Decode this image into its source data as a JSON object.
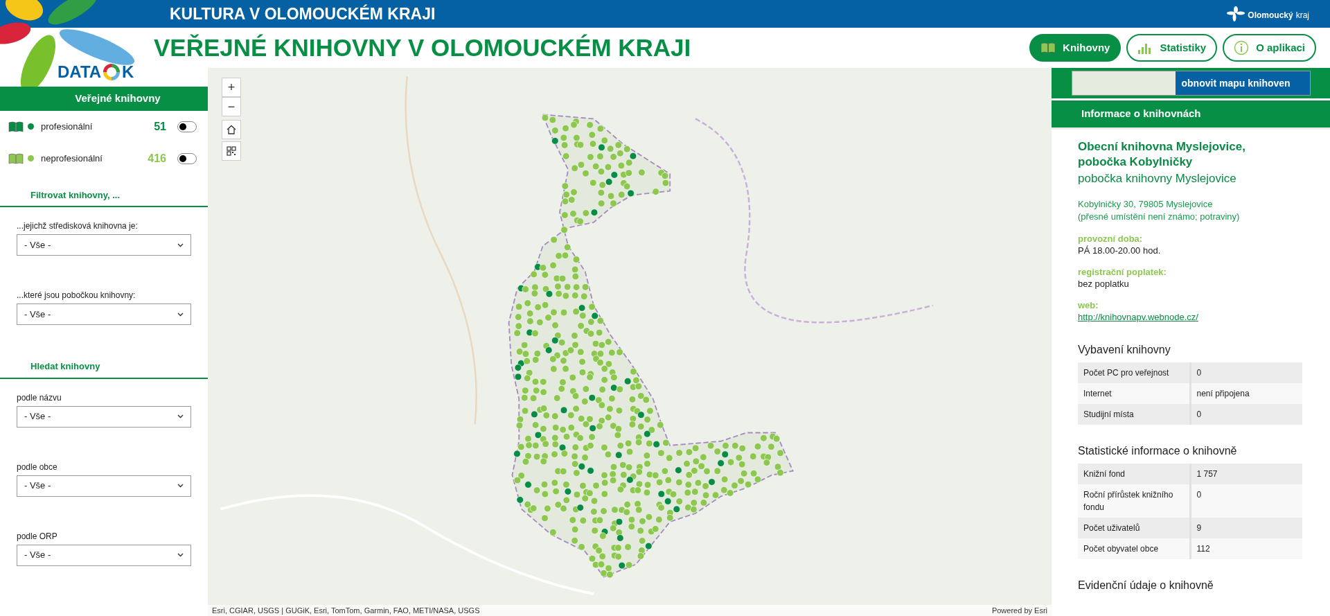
{
  "header": {
    "banner_title": "KULTURA V OLOMOUCKÉM KRAJI",
    "region_logo": {
      "name": "Olomoucký",
      "suffix": "kraj"
    },
    "logo": {
      "text": "DATA",
      "suffix": "K"
    },
    "app_title": "VEŘEJNÉ KNIHOVNY V OLOMOUCKÉM KRAJI",
    "nav": [
      {
        "label": "Knihovny",
        "kind": "book",
        "selected": true
      },
      {
        "label": "Statistiky",
        "kind": "chart",
        "selected": false
      },
      {
        "label": "O aplikaci",
        "kind": "info",
        "selected": false
      }
    ]
  },
  "sidebar": {
    "title": "Veřejné knihovny",
    "layers": [
      {
        "label": "profesionální",
        "count": "51",
        "color": "#078c45",
        "on": false
      },
      {
        "label": "neprofesionální",
        "count": "416",
        "color": "#8dc750",
        "on": false
      }
    ],
    "sections": [
      {
        "title": "Filtrovat knihovny, ...",
        "filters": [
          {
            "label": "...jejichž středisková knihovna je:",
            "value": "- Vše -"
          },
          {
            "label": "...které jsou pobočkou knihovny:",
            "value": "- Vše -"
          }
        ]
      },
      {
        "title": "Hledat knihovny",
        "filters": [
          {
            "label": "podle názvu",
            "value": "- Vše -"
          },
          {
            "label": "podle obce",
            "value": "- Vše -"
          },
          {
            "label": "podle ORP",
            "value": "- Vše -"
          }
        ]
      }
    ]
  },
  "map": {
    "controls": [
      {
        "kind": "zoom-in",
        "label": "+"
      },
      {
        "kind": "zoom-out",
        "label": "−"
      },
      {
        "kind": "home"
      },
      {
        "kind": "qr"
      }
    ],
    "attribution": "Esri, CGIAR, USGS | GUGiK, Esri, TomTom, Garmin, FAO, METI/NASA, USGS",
    "powered_by": "Powered by Esri"
  },
  "info_panel": {
    "refresh_button": "obnovit mapu knihoven",
    "title": "Informace o knihovnách",
    "library": {
      "name": "Obecní knihovna Myslejovice, pobočka Kobylničky",
      "subtitle": "pobočka knihovny Myslejovice",
      "address": "Kobylničky 30, 79805 Myslejovice",
      "address_note": "(přesné umístění není známo; potraviny)",
      "fields": [
        {
          "label": "provozní doba:",
          "value": "PÁ 18.00-20.00 hod.",
          "kind": "text"
        },
        {
          "label": "registrační poplatek:",
          "value": "bez poplatku",
          "kind": "text"
        },
        {
          "label": "web:",
          "value": "http://knihovnapv.webnode.cz/",
          "kind": "link"
        }
      ]
    },
    "tables": [
      {
        "title": "Vybavení knihovny",
        "rows": [
          [
            "Počet PC pro veřejnost",
            "0"
          ],
          [
            "Internet",
            "není připojena"
          ],
          [
            "Studijní místa",
            "0"
          ]
        ]
      },
      {
        "title": "Statistické informace o knihovně",
        "rows": [
          [
            "Knižní fond",
            "1 757"
          ],
          [
            "Roční přírůstek knižního fondu",
            "0"
          ],
          [
            "Počet uživatelů",
            "9"
          ],
          [
            "Počet obyvatel obce",
            "112"
          ]
        ]
      }
    ],
    "next_section_title": "Evidenční údaje o knihovně"
  }
}
